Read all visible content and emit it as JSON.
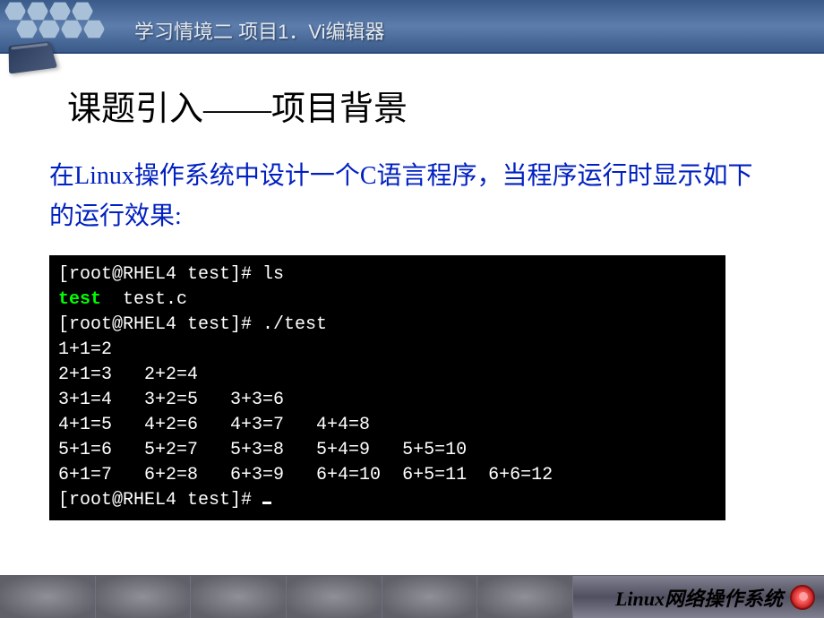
{
  "header": {
    "title": "学习情境二  项目1．Vi编辑器"
  },
  "section_title": "课题引入——项目背景",
  "description": "在Linux操作系统中设计一个C语言程序，当程序运行时显示如下的运行效果:",
  "terminal": {
    "prompt1_pre": "[root@RHEL4 test]# ",
    "cmd1": "ls",
    "ls_green": "test",
    "ls_rest": "  test.c",
    "prompt2_pre": "[root@RHEL4 test]# ",
    "cmd2": "./test",
    "out1": "1+1=2",
    "out2": "2+1=3   2+2=4",
    "out3": "3+1=4   3+2=5   3+3=6",
    "out4": "4+1=5   4+2=6   4+3=7   4+4=8",
    "out5": "5+1=6   5+2=7   5+3=8   5+4=9   5+5=10",
    "out6": "6+1=7   6+2=8   6+3=9   6+4=10  6+5=11  6+6=12",
    "prompt3": "[root@RHEL4 test]# "
  },
  "footer": {
    "text": "Linux网络操作系统"
  }
}
